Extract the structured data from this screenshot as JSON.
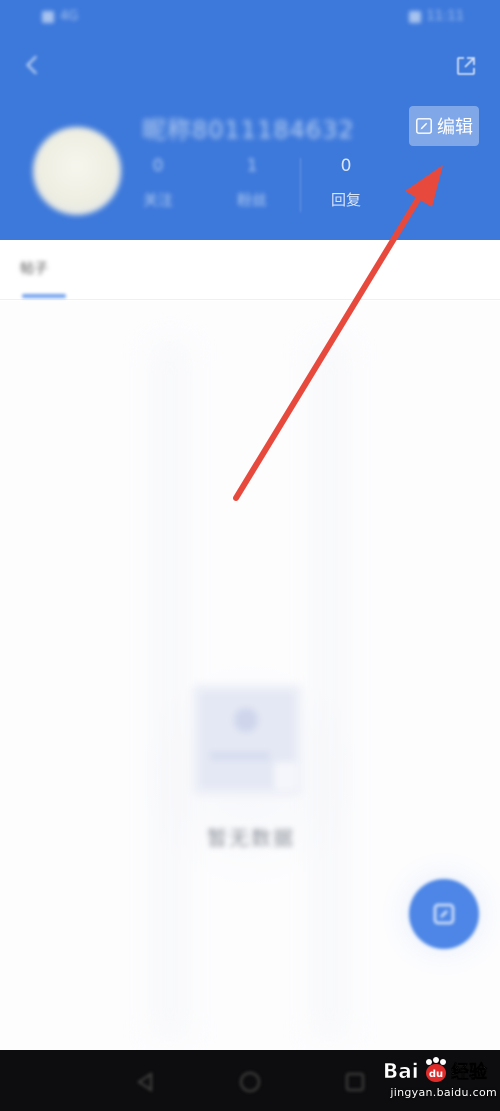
{
  "status_bar": {
    "left_text": "4G",
    "right_text": "11:11"
  },
  "profile": {
    "username": "昵称8011184632",
    "edit_label": "编辑",
    "stats": [
      {
        "value": "0",
        "label": "关注"
      },
      {
        "value": "1",
        "label": "粉丝"
      },
      {
        "value": "0",
        "label": "回复"
      }
    ]
  },
  "tabs": [
    {
      "label": "帖子"
    }
  ],
  "empty_state": {
    "text": "暂无数据"
  },
  "watermark": {
    "brand_text": "Bai du 经验",
    "url": "jingyan.baidu.com"
  },
  "colors": {
    "header_bg": "#3d79db",
    "accent": "#4d86e6",
    "arrow": "#e8493d",
    "nav_bg": "#0d0d0f"
  },
  "icons": {
    "back": "back-arrow-icon",
    "share": "share-icon",
    "edit": "edit-icon",
    "fab": "compose-icon"
  }
}
